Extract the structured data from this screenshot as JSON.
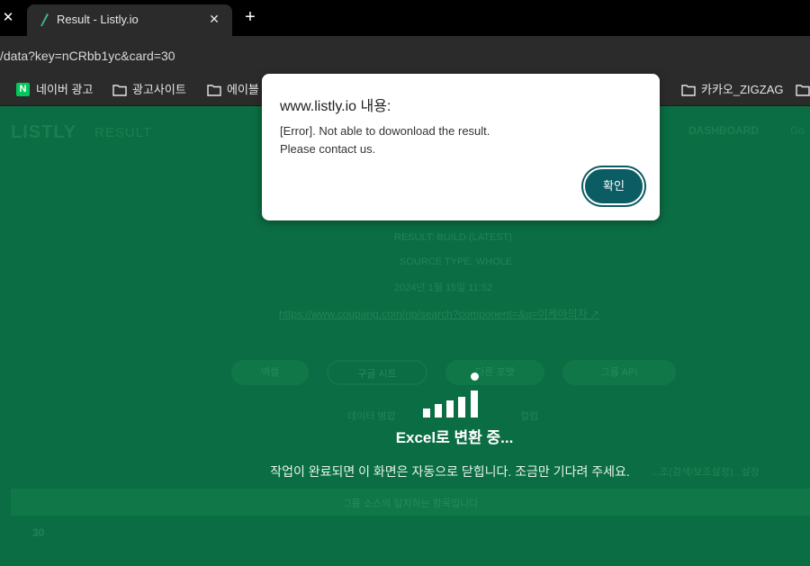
{
  "browser": {
    "tab": {
      "title": "Result - Listly.io"
    },
    "new_tab": "+",
    "close_glyph": "✕",
    "url": "/data?key=nCRbb1yc&card=30",
    "bookmarks": [
      {
        "label": "네이버 광고",
        "icon": "naver-icon"
      },
      {
        "label": "광고사이트",
        "icon": "folder-icon"
      },
      {
        "label": "에이블",
        "icon": "folder-icon"
      },
      {
        "label": "카카오_ZIGZAG",
        "icon": "folder-icon"
      }
    ]
  },
  "page": {
    "logo": "LISTLY",
    "logo_sub": "RESULT",
    "nav_dashboard": "DASHBOARD",
    "nav_extra": "Go",
    "meta_lines": [
      "RESULT: BUILD (LATEST)",
      "SOURCE TYPE: WHOLE",
      "2024년 1월 15일 11:52"
    ],
    "source_url": "https://www.coupang.com/np/search?component=&q=이케아의자 ↗",
    "buttons": [
      "엑셀",
      "구글 시트",
      "다른 포맷",
      "그룹 API"
    ],
    "checks": [
      "데이터 병합",
      "컬럼"
    ],
    "strip_text": "그룹 소스의 일치하는 항목입니다",
    "row_number": "30",
    "wait_side": "...조(검색/보조설정)...설정"
  },
  "loader": {
    "text": "Excel로 변환 중...",
    "wait_message": "작업이 완료되면 이 화면은 자동으로 닫힙니다. 조금만 기다려 주세요."
  },
  "dialog": {
    "title": "www.listly.io 내용:",
    "message": "[Error]. Not able to dowonload the result.\nPlease contact us.",
    "ok_label": "확인"
  }
}
